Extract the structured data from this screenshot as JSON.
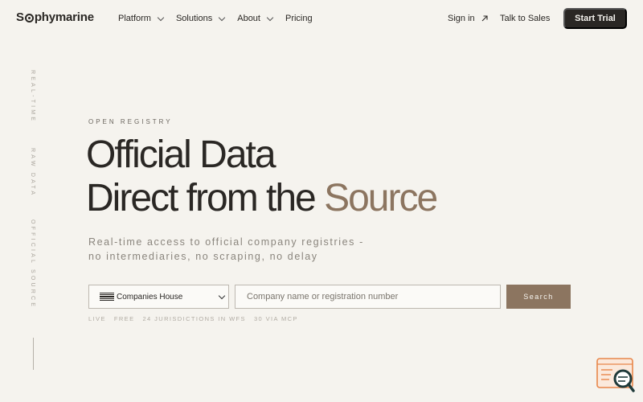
{
  "brand": {
    "name_prefix": "S",
    "name_suffix": "phymarine"
  },
  "nav": {
    "items": [
      {
        "label": "Platform",
        "has_dropdown": true
      },
      {
        "label": "Solutions",
        "has_dropdown": true
      },
      {
        "label": "About",
        "has_dropdown": true
      },
      {
        "label": "Pricing",
        "has_dropdown": false
      }
    ],
    "sign_in": "Sign in",
    "talk_to_sales": "Talk to Sales",
    "start_trial": "Start Trial"
  },
  "rail": [
    "REAL-TIME",
    "RAW DATA",
    "OFFICIAL SOURCE"
  ],
  "hero": {
    "eyebrow": "OPEN REGISTRY",
    "line1": "Official Data",
    "line2_prefix": "Direct from the ",
    "line2_accent": "Source",
    "sub_line1": "Real-time access to official company registries -",
    "sub_line2": "no intermediaries, no scraping, no delay"
  },
  "search": {
    "registry_selected": "Companies House",
    "placeholder": "Company name or registration number",
    "value": "",
    "button": "Search"
  },
  "meta": [
    "LIVE",
    "FREE",
    "24 JURISDICTIONS IN WFS",
    "30 VIA MCP"
  ],
  "colors": {
    "background": "#f5f3ee",
    "ink": "#2a2724",
    "accent": "#8c7560",
    "widget": "#e8864a"
  }
}
